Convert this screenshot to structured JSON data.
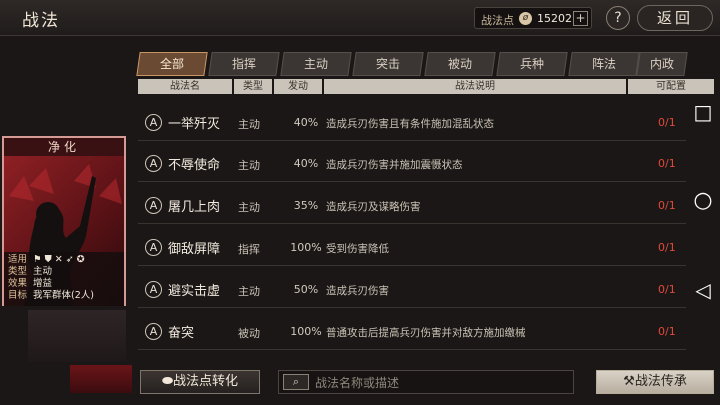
{
  "header": {
    "title": "战法",
    "points_label": "战法点",
    "points_coin_icon": "ink-coin-icon",
    "points_value": "15202",
    "add_label": "+",
    "help_label": "?",
    "back_label": "返回"
  },
  "tabs": [
    "全部",
    "指挥",
    "主动",
    "突击",
    "被动",
    "兵种",
    "阵法",
    "内政"
  ],
  "active_tab": 0,
  "columns": {
    "name": "战法名",
    "type": "类型",
    "trigger": "发动",
    "desc": "战法说明",
    "config": "可配置"
  },
  "rows": [
    {
      "icon": "A",
      "name": "一举歼灭",
      "type": "主动",
      "pct": "40%",
      "desc": "造成兵刃伤害且有条件施加混乱状态",
      "config": "0/1"
    },
    {
      "icon": "A",
      "name": "不辱使命",
      "type": "主动",
      "pct": "40%",
      "desc": "造成兵刃伤害并施加震慑状态",
      "config": "0/1"
    },
    {
      "icon": "A",
      "name": "屠几上肉",
      "type": "主动",
      "pct": "35%",
      "desc": "造成兵刃及谋略伤害",
      "config": "0/1"
    },
    {
      "icon": "A",
      "name": "御敌屏障",
      "type": "指挥",
      "pct": "100%",
      "desc": "受到伤害降低",
      "config": "0/1"
    },
    {
      "icon": "A",
      "name": "避实击虚",
      "type": "主动",
      "pct": "50%",
      "desc": "造成兵刃伤害",
      "config": "0/1"
    },
    {
      "icon": "A",
      "name": "奋突",
      "type": "被动",
      "pct": "100%",
      "desc": "普通攻击后提高兵刃伤害并对敌方施加缴械",
      "config": "0/1"
    }
  ],
  "card": {
    "title": "净化",
    "rows": [
      {
        "k": "适用",
        "v": "⚑ ⛊ ✕ ➶ ✪"
      },
      {
        "k": "类型",
        "v": "主动"
      },
      {
        "k": "效果",
        "v": "增益"
      },
      {
        "k": "目标",
        "v": "我军群体(2人)"
      }
    ]
  },
  "bottom": {
    "convert_label": "战法点转化",
    "search_placeholder": "战法名称或描述",
    "inherit_label": "战法传承"
  },
  "nav": {
    "recent": "□",
    "home": "○",
    "back": "◁"
  },
  "colors": {
    "accent": "#c79563",
    "config_red": "#e04a3a",
    "card_red": "#8e2024"
  }
}
